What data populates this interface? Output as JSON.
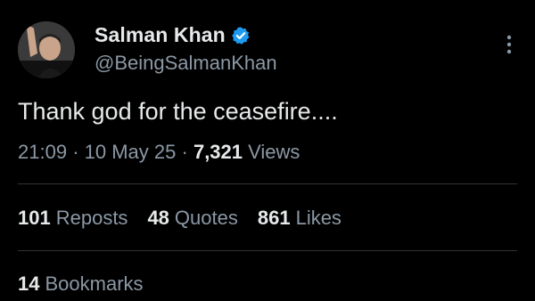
{
  "author": {
    "display_name": "Salman Khan",
    "handle": "@BeingSalmanKhan",
    "verified_icon": "verified-badge-icon",
    "verified_color": "#1d9bf0"
  },
  "tweet": {
    "text": "Thank god for the ceasefire....",
    "time": "21:09",
    "date": "10 May 25",
    "views_count": "7,321",
    "views_label": "Views",
    "separator": "·"
  },
  "stats": {
    "reposts_count": "101",
    "reposts_label": "Reposts",
    "quotes_count": "48",
    "quotes_label": "Quotes",
    "likes_count": "861",
    "likes_label": "Likes"
  },
  "bookmarks": {
    "count": "14",
    "label": "Bookmarks"
  },
  "colors": {
    "background": "#000000",
    "primary_text": "#e7e9ea",
    "secondary_text": "#8b98a5",
    "divider": "#2f3336"
  }
}
